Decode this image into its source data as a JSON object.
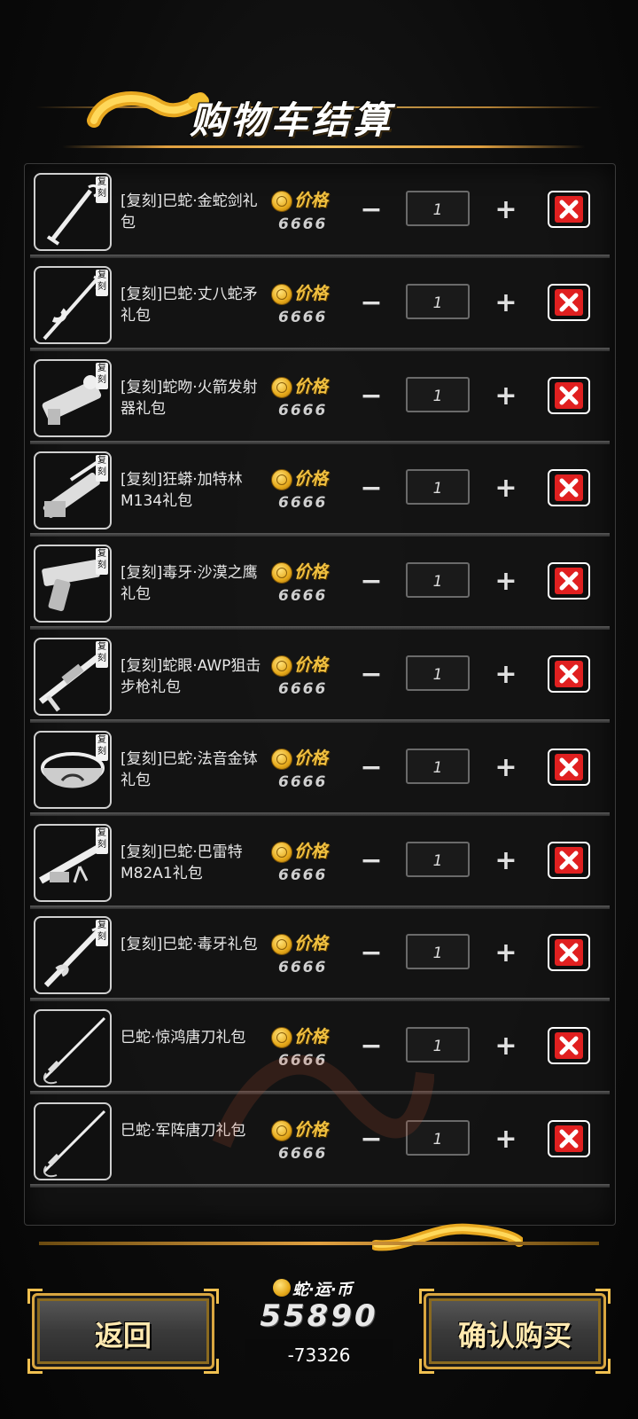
{
  "header": {
    "title": "购物车结算"
  },
  "items": [
    {
      "tag": "复刻",
      "name": "[复刻]巳蛇·金蛇剑礼包",
      "price_label": "价格",
      "price": "6666",
      "qty": "1",
      "icon": "sword-icon"
    },
    {
      "tag": "复刻",
      "name": "[复刻]巳蛇·丈八蛇矛礼包",
      "price_label": "价格",
      "price": "6666",
      "qty": "1",
      "icon": "spear-icon"
    },
    {
      "tag": "复刻",
      "name": "[复刻]蛇吻·火箭发射器礼包",
      "price_label": "价格",
      "price": "6666",
      "qty": "1",
      "icon": "rocket-launcher-icon"
    },
    {
      "tag": "复刻",
      "name": "[复刻]狂蟒·加特林M134礼包",
      "price_label": "价格",
      "price": "6666",
      "qty": "1",
      "icon": "gatling-gun-icon"
    },
    {
      "tag": "复刻",
      "name": "[复刻]毒牙·沙漠之鹰礼包",
      "price_label": "价格",
      "price": "6666",
      "qty": "1",
      "icon": "pistol-icon"
    },
    {
      "tag": "复刻",
      "name": "[复刻]蛇眼·AWP狙击步枪礼包",
      "price_label": "价格",
      "price": "6666",
      "qty": "1",
      "icon": "sniper-rifle-icon"
    },
    {
      "tag": "复刻",
      "name": "[复刻]巳蛇·法音金钵礼包",
      "price_label": "价格",
      "price": "6666",
      "qty": "1",
      "icon": "golden-bowl-icon"
    },
    {
      "tag": "复刻",
      "name": "[复刻]巳蛇·巴雷特M82A1礼包",
      "price_label": "价格",
      "price": "6666",
      "qty": "1",
      "icon": "barrett-rifle-icon"
    },
    {
      "tag": "复刻",
      "name": "[复刻]巳蛇·毒牙礼包",
      "price_label": "价格",
      "price": "6666",
      "qty": "1",
      "icon": "dagger-icon"
    },
    {
      "tag": "",
      "name": "巳蛇·惊鸿唐刀礼包",
      "price_label": "价格",
      "price": "6666",
      "qty": "1",
      "icon": "tang-sword-icon"
    },
    {
      "tag": "",
      "name": "巳蛇·军阵唐刀礼包",
      "price_label": "价格",
      "price": "6666",
      "qty": "1",
      "icon": "tang-sword-icon"
    }
  ],
  "controls": {
    "minus": "−",
    "plus": "+"
  },
  "footer": {
    "back_label": "返回",
    "confirm_label": "确认购买",
    "currency_name": "蛇·运·币",
    "currency_balance": "55890",
    "currency_delta": "-73326"
  },
  "colors": {
    "accent": "#f0c040",
    "delete": "#e02020",
    "frame": "#d9a640"
  }
}
